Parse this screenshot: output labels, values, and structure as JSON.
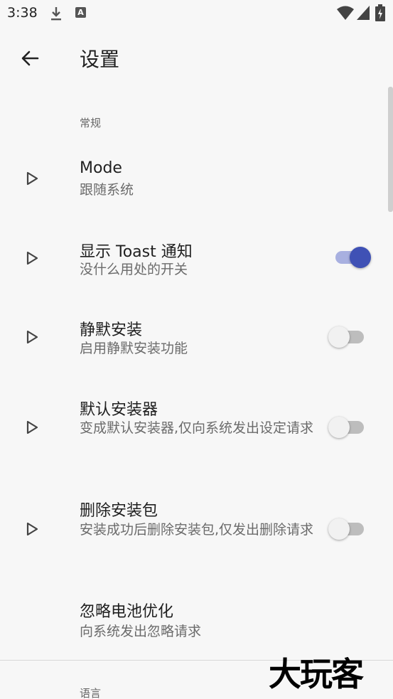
{
  "status_bar": {
    "time": "3:38",
    "badge_letter": "A"
  },
  "toolbar": {
    "title": "设置"
  },
  "categories": {
    "general": "常规",
    "language": "语言"
  },
  "preferences": [
    {
      "title": "Mode",
      "summary": "跟随系统"
    },
    {
      "title": "显示 Toast 通知",
      "summary": "没什么用处的开关",
      "switch_on": true
    },
    {
      "title": "静默安装",
      "summary": "启用静默安装功能",
      "switch_on": false
    },
    {
      "title": "默认安装器",
      "summary": "变成默认安装器,仅向系统发出设定请求",
      "switch_on": false
    },
    {
      "title": "删除安装包",
      "summary": "安装成功后删除安装包,仅发出删除请求",
      "switch_on": false
    },
    {
      "title": "忽略电池优化",
      "summary": "向系统发出忽略请求"
    }
  ],
  "colors": {
    "accent": "#3f51b5",
    "background": "#f7f7f7"
  },
  "watermark": "大玩客"
}
